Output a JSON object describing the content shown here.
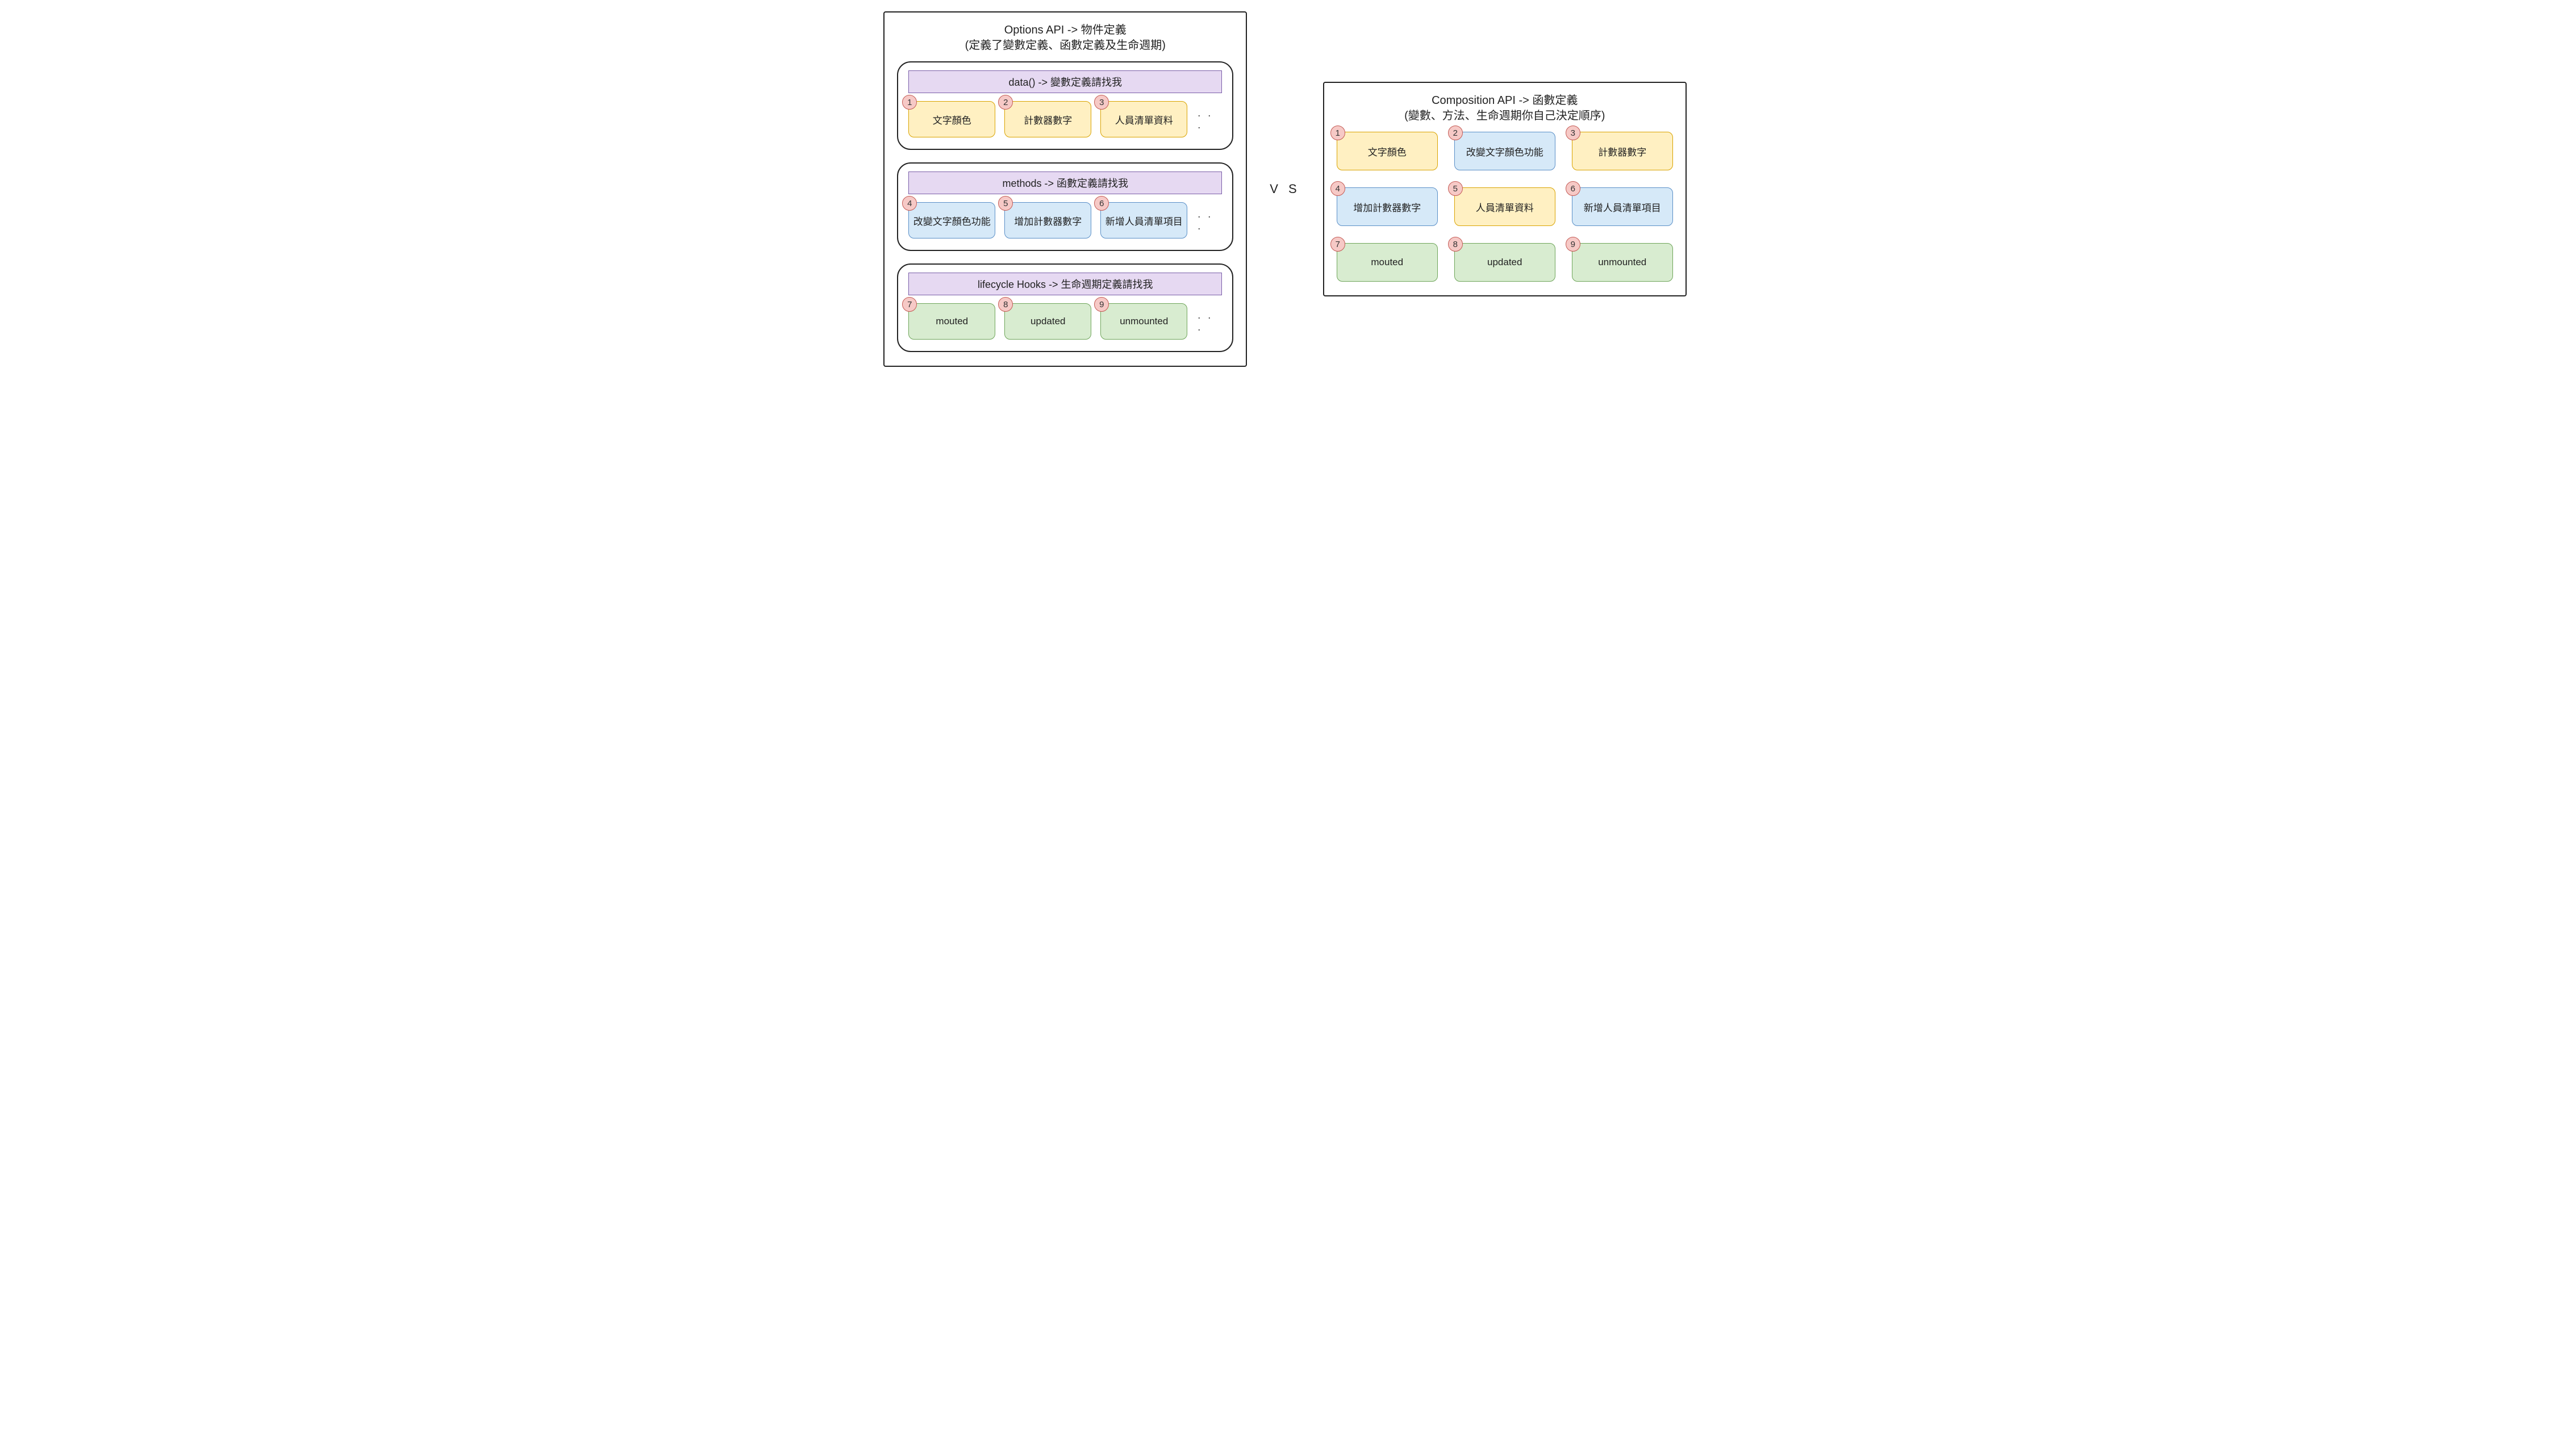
{
  "left": {
    "title_line1": "Options API -> 物件定義",
    "title_line2": "(定義了變數定義、函數定義及生命週期)",
    "sections": [
      {
        "header": "data() -> 變數定義請找我",
        "color": "yellow",
        "items": [
          {
            "num": "1",
            "label": "文字顏色"
          },
          {
            "num": "2",
            "label": "計數器數字"
          },
          {
            "num": "3",
            "label": "人員清單資料"
          }
        ],
        "ellipsis": ". . ."
      },
      {
        "header": "methods -> 函數定義請找我",
        "color": "blue",
        "items": [
          {
            "num": "4",
            "label": "改變文字顏色功能"
          },
          {
            "num": "5",
            "label": "增加計數器數字"
          },
          {
            "num": "6",
            "label": "新增人員清單項目"
          }
        ],
        "ellipsis": ". . ."
      },
      {
        "header": "lifecycle Hooks -> 生命週期定義請找我",
        "color": "green",
        "items": [
          {
            "num": "7",
            "label": "mouted"
          },
          {
            "num": "8",
            "label": "updated"
          },
          {
            "num": "9",
            "label": "unmounted"
          }
        ],
        "ellipsis": ". . ."
      }
    ]
  },
  "vs": "V S",
  "right": {
    "title_line1": "Composition API -> 函數定義",
    "title_line2": "(變數、方法、生命週期你自己決定順序)",
    "items": [
      {
        "num": "1",
        "label": "文字顏色",
        "color": "yellow"
      },
      {
        "num": "2",
        "label": "改變文字顏色功能",
        "color": "blue"
      },
      {
        "num": "3",
        "label": "計數器數字",
        "color": "yellow"
      },
      {
        "num": "4",
        "label": "增加計數器數字",
        "color": "blue"
      },
      {
        "num": "5",
        "label": "人員清單資料",
        "color": "yellow"
      },
      {
        "num": "6",
        "label": "新增人員清單項目",
        "color": "blue"
      },
      {
        "num": "7",
        "label": "mouted",
        "color": "green"
      },
      {
        "num": "8",
        "label": "updated",
        "color": "green"
      },
      {
        "num": "9",
        "label": "unmounted",
        "color": "green"
      }
    ]
  }
}
